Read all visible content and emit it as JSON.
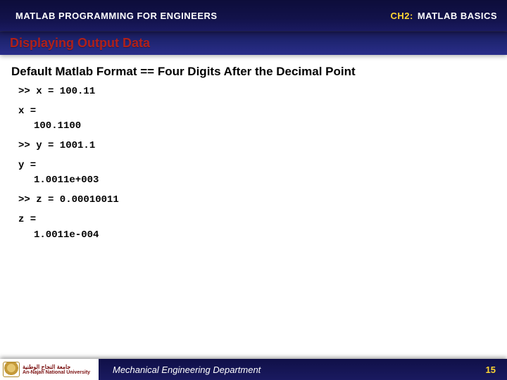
{
  "header": {
    "left": "MATLAB PROGRAMMING FOR ENGINEERS",
    "chapter_prefix": "CH2:",
    "right": "MATLAB BASICS"
  },
  "subtitle": "Displaying Output Data",
  "lead": "Default Matlab Format == Four Digits After the Decimal Point",
  "code": {
    "l1": ">> x = 100.11",
    "l2": "x =",
    "l3": "100.1100",
    "l4": ">> y = 1001.1",
    "l5": "y =",
    "l6": "1.0011e+003",
    "l7": ">> z = 0.00010011",
    "l8": "z =",
    "l9": "1.0011e-004"
  },
  "footer": {
    "logo_ar": "جامعة النجاح الوطنية",
    "logo_en": "An-Najah National University",
    "department": "Mechanical Engineering Department",
    "page": "15"
  }
}
